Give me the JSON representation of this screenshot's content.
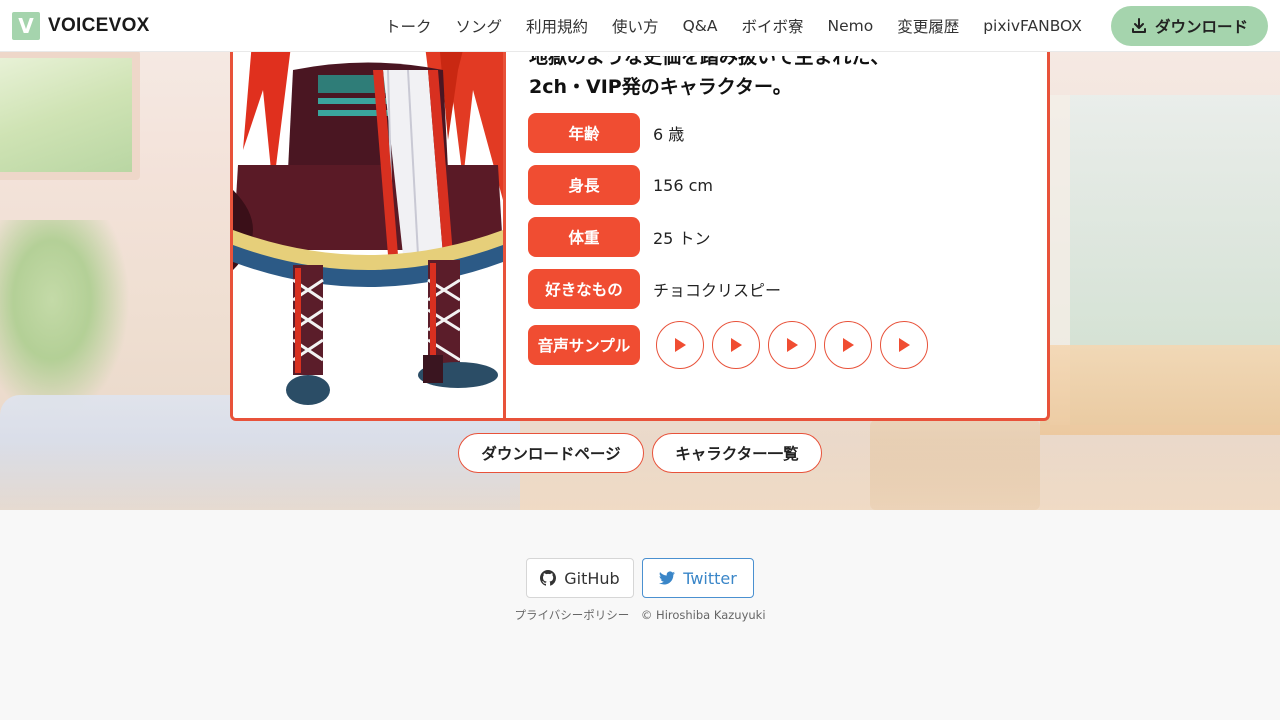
{
  "header": {
    "logo_letter": "V",
    "logo_text": "VOICEVOX",
    "nav": [
      "トーク",
      "ソング",
      "利用規約",
      "使い方",
      "Q&A",
      "ボイボ寮",
      "Nemo",
      "変更履歴",
      "pixivFANBOX"
    ],
    "download_label": "ダウンロード",
    "accent_color": "#a5d4ad"
  },
  "character": {
    "description_line1": "地獄のような史価を踏み抜いて生まれた、",
    "description_line2": "2ch・VIP発のキャラクター。",
    "profile": [
      {
        "label": "年齢",
        "value": "6 歳"
      },
      {
        "label": "身長",
        "value": "156 cm"
      },
      {
        "label": "体重",
        "value": "25 トン"
      },
      {
        "label": "好きなもの",
        "value": "チョコクリスピー"
      }
    ],
    "sample_label": "音声サンプル",
    "sample_count": 5,
    "theme_color": "#e8523a"
  },
  "links": {
    "download_page": "ダウンロードページ",
    "character_list": "キャラクター一覧"
  },
  "footer": {
    "github": "GitHub",
    "twitter": "Twitter",
    "privacy": "プライバシーポリシー",
    "copyright": "© Hiroshiba Kazuyuki"
  }
}
